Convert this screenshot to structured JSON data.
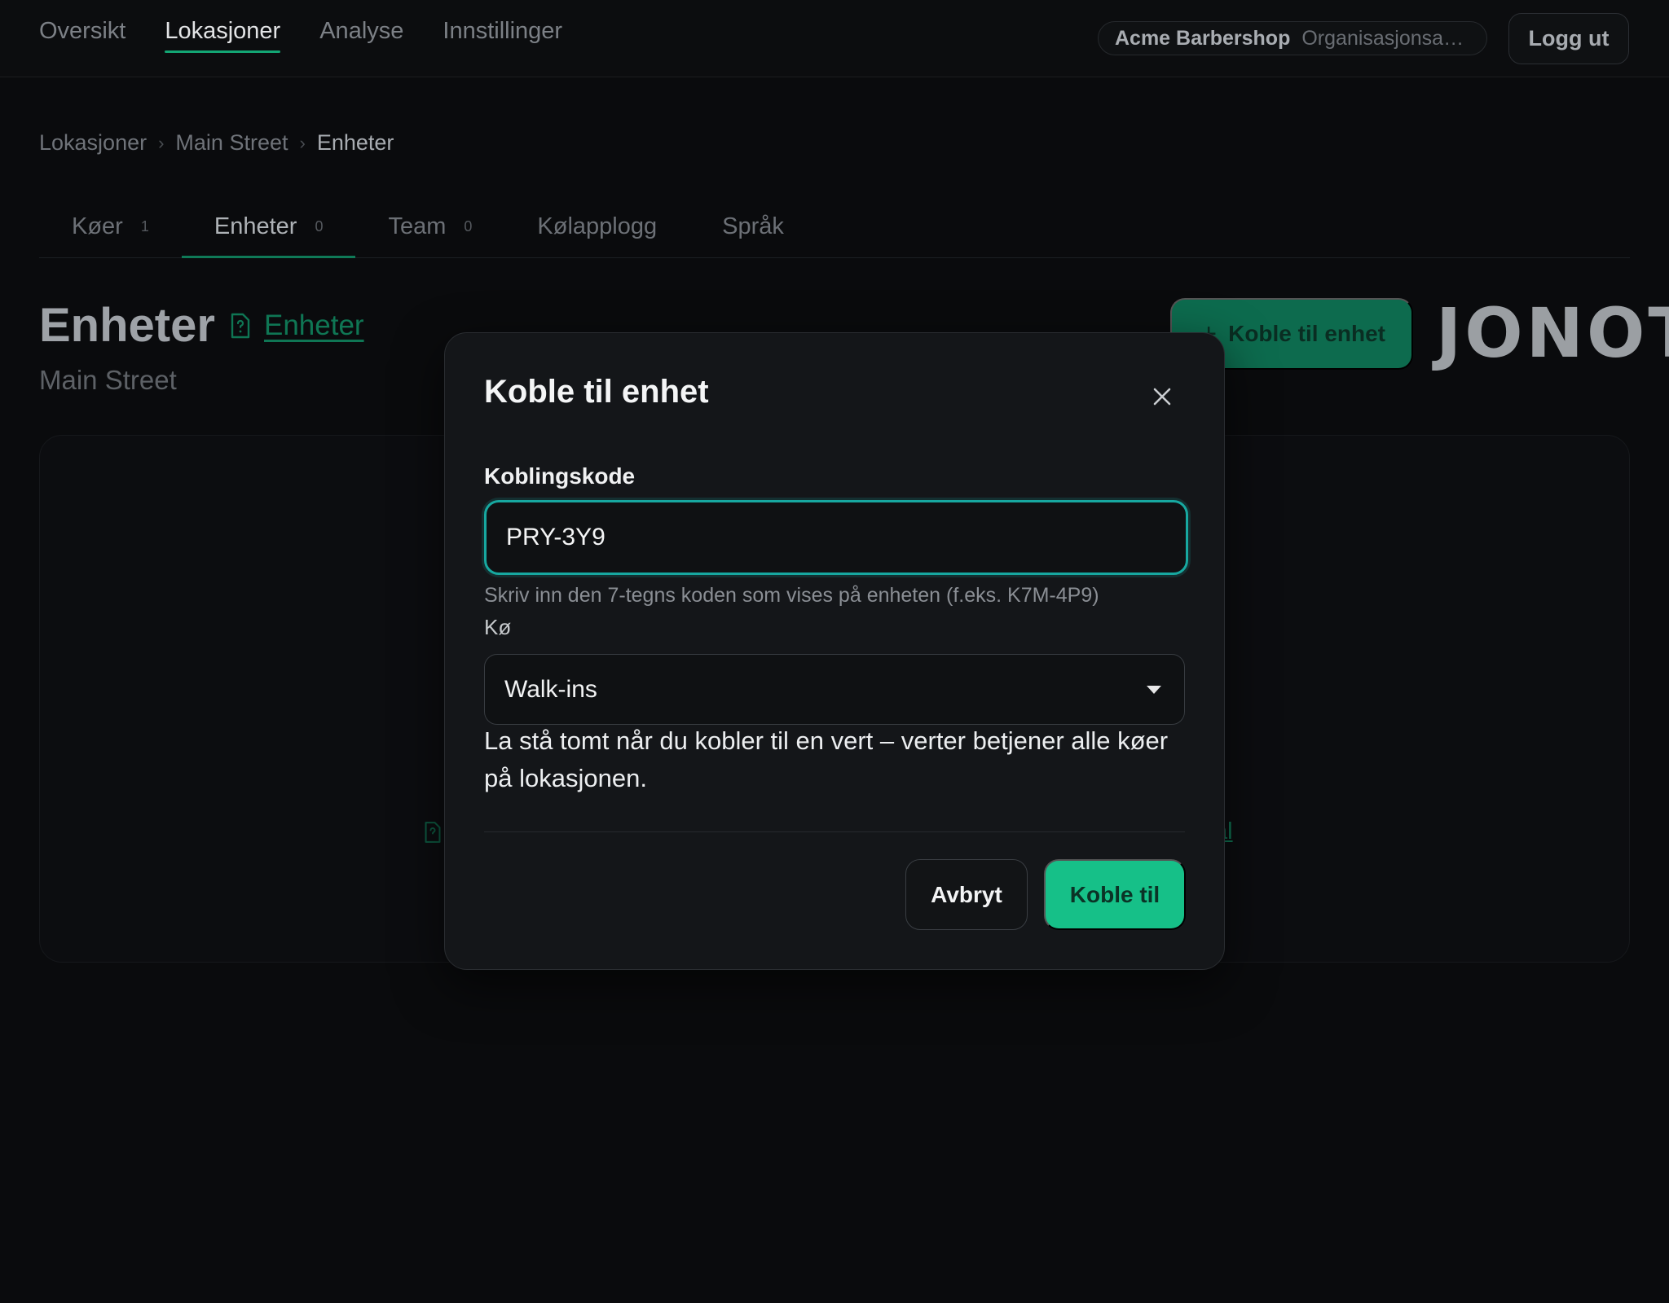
{
  "nav": {
    "items": [
      {
        "label": "Oversikt",
        "active": false
      },
      {
        "label": "Lokasjoner",
        "active": true
      },
      {
        "label": "Analyse",
        "active": false
      },
      {
        "label": "Innstillinger",
        "active": false
      }
    ],
    "org_name": "Acme Barbershop",
    "org_sub": "Organisasjonsan...",
    "logout_label": "Logg ut"
  },
  "breadcrumb": [
    "Lokasjoner",
    "Main Street",
    "Enheter"
  ],
  "tabs": [
    {
      "label": "Køer",
      "count": "1",
      "active": false
    },
    {
      "label": "Enheter",
      "count": "0",
      "active": true
    },
    {
      "label": "Team",
      "count": "0",
      "active": false
    },
    {
      "label": "Kølapplogg",
      "count": "",
      "active": false
    },
    {
      "label": "Språk",
      "count": "",
      "active": false
    }
  ],
  "page": {
    "title": "Enheter",
    "doc_link": "Enheter",
    "subtitle": "Main Street",
    "connect_button": "Koble til enhet",
    "brand": "JONOT",
    "bg_link_tail": "al"
  },
  "modal": {
    "title": "Koble til enhet",
    "code_label": "Koblingskode",
    "code_value": "PRY-3Y9",
    "code_hint": "Skriv inn den 7-tegns koden som vises på enheten (f.eks. K7M-4P9)",
    "queue_label": "Kø",
    "queue_value": "Walk-ins",
    "queue_help": "La stå tomt når du kobler til en vert – verter betjener alle køer på lokasjonen.",
    "cancel_label": "Avbryt",
    "submit_label": "Koble til"
  },
  "colors": {
    "accent": "#16c088",
    "focus_ring": "#17a8a0",
    "link": "#0f7654"
  }
}
